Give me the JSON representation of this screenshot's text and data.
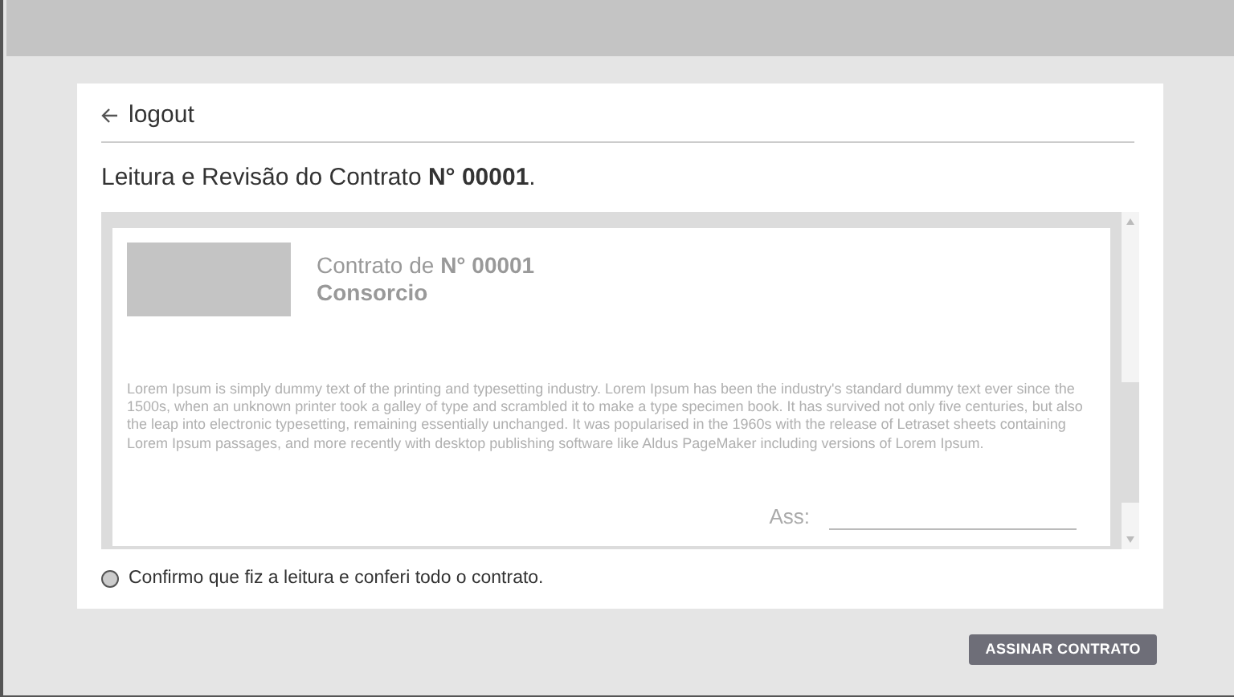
{
  "back_link": {
    "label": "logout"
  },
  "heading": "Leitura e Revisão do Contrato **N° 00001**.",
  "contract": {
    "title": "Contrato de  **N° 00001**",
    "subtitle": "Consorcio",
    "body": "Lorem Ipsum is simply dummy text of the printing and typesetting industry. Lorem Ipsum has been the industry's standard dummy text ever since the 1500s, when an unknown printer took a galley of type and scrambled it to make a type specimen book. It has survived not only five centuries, but also the leap into electronic typesetting, remaining essentially unchanged. It was popularised in the 1960s with the release of Letraset sheets containing Lorem Ipsum passages, and more recently with desktop publishing software like Aldus PageMaker including versions of Lorem Ipsum.",
    "signature_label": "Ass:"
  },
  "confirmation": {
    "label": "Confirmo que fiz a leitura e conferi todo o contrato.",
    "checked": false
  },
  "sign_button": {
    "label": "ASSINAR CONTRATO"
  }
}
